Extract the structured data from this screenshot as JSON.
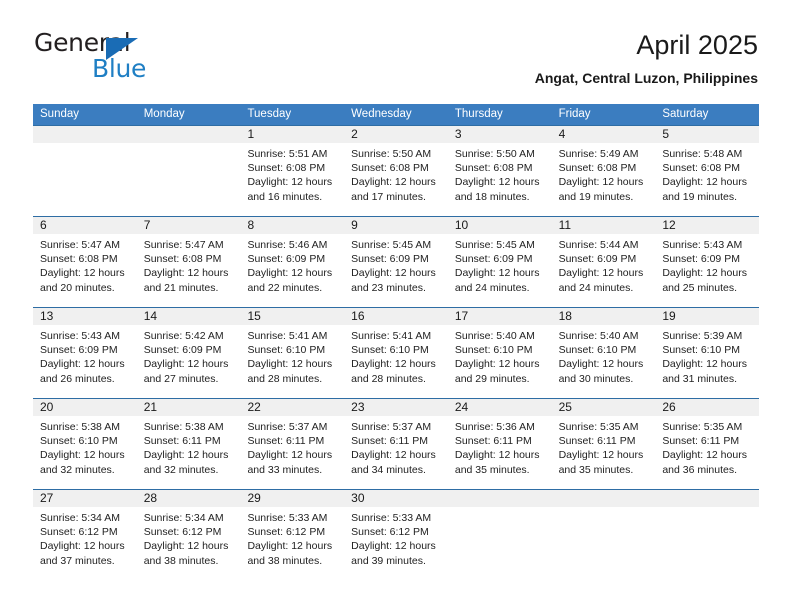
{
  "brand": {
    "name_top": "General",
    "name_bottom": "Blue",
    "triangle_color": "#1a6cb5",
    "blue_text_color": "#1f7fc4"
  },
  "header": {
    "title": "April 2025",
    "location": "Angat, Central Luzon, Philippines"
  },
  "theme": {
    "header_bar": "#3b7dc0",
    "row_separator": "#2e6da4",
    "daynum_band": "#f0f0f0",
    "text": "#1a1a1a"
  },
  "weekdays": [
    "Sunday",
    "Monday",
    "Tuesday",
    "Wednesday",
    "Thursday",
    "Friday",
    "Saturday"
  ],
  "weeks": [
    [
      {
        "day": "",
        "sunrise": "",
        "sunset": "",
        "daylight_1": "",
        "daylight_2": ""
      },
      {
        "day": "",
        "sunrise": "",
        "sunset": "",
        "daylight_1": "",
        "daylight_2": ""
      },
      {
        "day": "1",
        "sunrise": "Sunrise: 5:51 AM",
        "sunset": "Sunset: 6:08 PM",
        "daylight_1": "Daylight: 12 hours",
        "daylight_2": "and 16 minutes."
      },
      {
        "day": "2",
        "sunrise": "Sunrise: 5:50 AM",
        "sunset": "Sunset: 6:08 PM",
        "daylight_1": "Daylight: 12 hours",
        "daylight_2": "and 17 minutes."
      },
      {
        "day": "3",
        "sunrise": "Sunrise: 5:50 AM",
        "sunset": "Sunset: 6:08 PM",
        "daylight_1": "Daylight: 12 hours",
        "daylight_2": "and 18 minutes."
      },
      {
        "day": "4",
        "sunrise": "Sunrise: 5:49 AM",
        "sunset": "Sunset: 6:08 PM",
        "daylight_1": "Daylight: 12 hours",
        "daylight_2": "and 19 minutes."
      },
      {
        "day": "5",
        "sunrise": "Sunrise: 5:48 AM",
        "sunset": "Sunset: 6:08 PM",
        "daylight_1": "Daylight: 12 hours",
        "daylight_2": "and 19 minutes."
      }
    ],
    [
      {
        "day": "6",
        "sunrise": "Sunrise: 5:47 AM",
        "sunset": "Sunset: 6:08 PM",
        "daylight_1": "Daylight: 12 hours",
        "daylight_2": "and 20 minutes."
      },
      {
        "day": "7",
        "sunrise": "Sunrise: 5:47 AM",
        "sunset": "Sunset: 6:08 PM",
        "daylight_1": "Daylight: 12 hours",
        "daylight_2": "and 21 minutes."
      },
      {
        "day": "8",
        "sunrise": "Sunrise: 5:46 AM",
        "sunset": "Sunset: 6:09 PM",
        "daylight_1": "Daylight: 12 hours",
        "daylight_2": "and 22 minutes."
      },
      {
        "day": "9",
        "sunrise": "Sunrise: 5:45 AM",
        "sunset": "Sunset: 6:09 PM",
        "daylight_1": "Daylight: 12 hours",
        "daylight_2": "and 23 minutes."
      },
      {
        "day": "10",
        "sunrise": "Sunrise: 5:45 AM",
        "sunset": "Sunset: 6:09 PM",
        "daylight_1": "Daylight: 12 hours",
        "daylight_2": "and 24 minutes."
      },
      {
        "day": "11",
        "sunrise": "Sunrise: 5:44 AM",
        "sunset": "Sunset: 6:09 PM",
        "daylight_1": "Daylight: 12 hours",
        "daylight_2": "and 24 minutes."
      },
      {
        "day": "12",
        "sunrise": "Sunrise: 5:43 AM",
        "sunset": "Sunset: 6:09 PM",
        "daylight_1": "Daylight: 12 hours",
        "daylight_2": "and 25 minutes."
      }
    ],
    [
      {
        "day": "13",
        "sunrise": "Sunrise: 5:43 AM",
        "sunset": "Sunset: 6:09 PM",
        "daylight_1": "Daylight: 12 hours",
        "daylight_2": "and 26 minutes."
      },
      {
        "day": "14",
        "sunrise": "Sunrise: 5:42 AM",
        "sunset": "Sunset: 6:09 PM",
        "daylight_1": "Daylight: 12 hours",
        "daylight_2": "and 27 minutes."
      },
      {
        "day": "15",
        "sunrise": "Sunrise: 5:41 AM",
        "sunset": "Sunset: 6:10 PM",
        "daylight_1": "Daylight: 12 hours",
        "daylight_2": "and 28 minutes."
      },
      {
        "day": "16",
        "sunrise": "Sunrise: 5:41 AM",
        "sunset": "Sunset: 6:10 PM",
        "daylight_1": "Daylight: 12 hours",
        "daylight_2": "and 28 minutes."
      },
      {
        "day": "17",
        "sunrise": "Sunrise: 5:40 AM",
        "sunset": "Sunset: 6:10 PM",
        "daylight_1": "Daylight: 12 hours",
        "daylight_2": "and 29 minutes."
      },
      {
        "day": "18",
        "sunrise": "Sunrise: 5:40 AM",
        "sunset": "Sunset: 6:10 PM",
        "daylight_1": "Daylight: 12 hours",
        "daylight_2": "and 30 minutes."
      },
      {
        "day": "19",
        "sunrise": "Sunrise: 5:39 AM",
        "sunset": "Sunset: 6:10 PM",
        "daylight_1": "Daylight: 12 hours",
        "daylight_2": "and 31 minutes."
      }
    ],
    [
      {
        "day": "20",
        "sunrise": "Sunrise: 5:38 AM",
        "sunset": "Sunset: 6:10 PM",
        "daylight_1": "Daylight: 12 hours",
        "daylight_2": "and 32 minutes."
      },
      {
        "day": "21",
        "sunrise": "Sunrise: 5:38 AM",
        "sunset": "Sunset: 6:11 PM",
        "daylight_1": "Daylight: 12 hours",
        "daylight_2": "and 32 minutes."
      },
      {
        "day": "22",
        "sunrise": "Sunrise: 5:37 AM",
        "sunset": "Sunset: 6:11 PM",
        "daylight_1": "Daylight: 12 hours",
        "daylight_2": "and 33 minutes."
      },
      {
        "day": "23",
        "sunrise": "Sunrise: 5:37 AM",
        "sunset": "Sunset: 6:11 PM",
        "daylight_1": "Daylight: 12 hours",
        "daylight_2": "and 34 minutes."
      },
      {
        "day": "24",
        "sunrise": "Sunrise: 5:36 AM",
        "sunset": "Sunset: 6:11 PM",
        "daylight_1": "Daylight: 12 hours",
        "daylight_2": "and 35 minutes."
      },
      {
        "day": "25",
        "sunrise": "Sunrise: 5:35 AM",
        "sunset": "Sunset: 6:11 PM",
        "daylight_1": "Daylight: 12 hours",
        "daylight_2": "and 35 minutes."
      },
      {
        "day": "26",
        "sunrise": "Sunrise: 5:35 AM",
        "sunset": "Sunset: 6:11 PM",
        "daylight_1": "Daylight: 12 hours",
        "daylight_2": "and 36 minutes."
      }
    ],
    [
      {
        "day": "27",
        "sunrise": "Sunrise: 5:34 AM",
        "sunset": "Sunset: 6:12 PM",
        "daylight_1": "Daylight: 12 hours",
        "daylight_2": "and 37 minutes."
      },
      {
        "day": "28",
        "sunrise": "Sunrise: 5:34 AM",
        "sunset": "Sunset: 6:12 PM",
        "daylight_1": "Daylight: 12 hours",
        "daylight_2": "and 38 minutes."
      },
      {
        "day": "29",
        "sunrise": "Sunrise: 5:33 AM",
        "sunset": "Sunset: 6:12 PM",
        "daylight_1": "Daylight: 12 hours",
        "daylight_2": "and 38 minutes."
      },
      {
        "day": "30",
        "sunrise": "Sunrise: 5:33 AM",
        "sunset": "Sunset: 6:12 PM",
        "daylight_1": "Daylight: 12 hours",
        "daylight_2": "and 39 minutes."
      },
      {
        "day": "",
        "sunrise": "",
        "sunset": "",
        "daylight_1": "",
        "daylight_2": ""
      },
      {
        "day": "",
        "sunrise": "",
        "sunset": "",
        "daylight_1": "",
        "daylight_2": ""
      },
      {
        "day": "",
        "sunrise": "",
        "sunset": "",
        "daylight_1": "",
        "daylight_2": ""
      }
    ]
  ]
}
